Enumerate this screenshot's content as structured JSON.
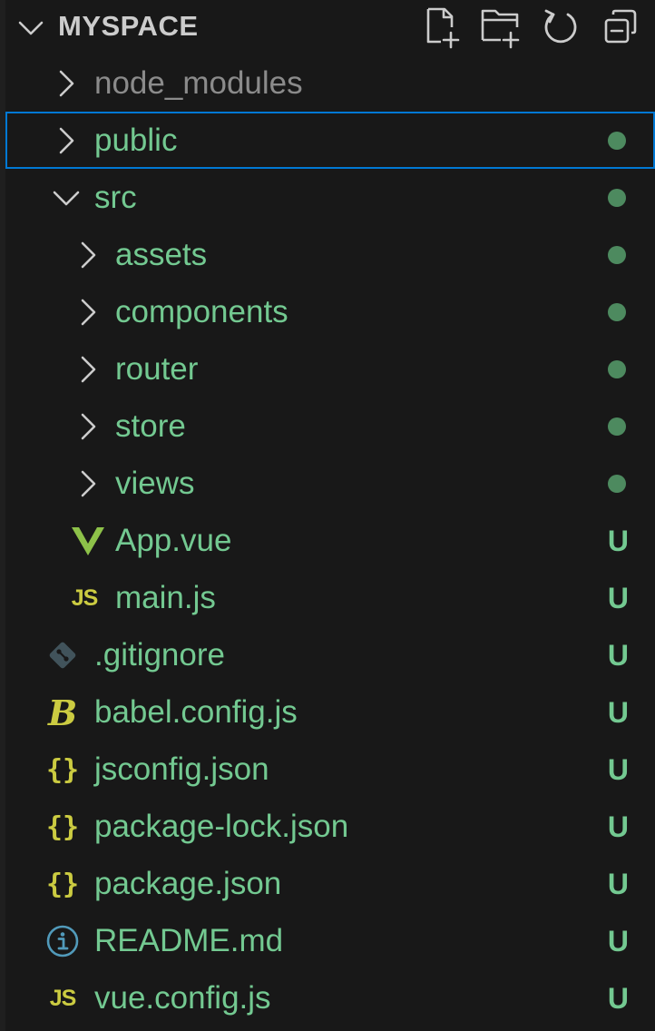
{
  "explorer": {
    "workspace_title": "MYSPACE",
    "header_icons": [
      "new-file-icon",
      "new-folder-icon",
      "refresh-icon",
      "collapse-all-icon"
    ]
  },
  "colors": {
    "background": "#181818",
    "untracked_green": "#73c991",
    "ignored_gray": "#8b8b8b",
    "selection_border": "#0078d4",
    "js_yellow": "#cbcb41",
    "vue_green": "#8dc149",
    "info_blue": "#519aba"
  },
  "tree": [
    {
      "label": "node_modules",
      "type": "folder",
      "expanded": false,
      "depth": 0,
      "status": "ignored",
      "decoration": ""
    },
    {
      "label": "public",
      "type": "folder",
      "expanded": false,
      "depth": 0,
      "status": "untracked",
      "decoration": "dot",
      "selected": true
    },
    {
      "label": "src",
      "type": "folder",
      "expanded": true,
      "depth": 0,
      "status": "untracked",
      "decoration": "dot"
    },
    {
      "label": "assets",
      "type": "folder",
      "expanded": false,
      "depth": 1,
      "status": "untracked",
      "decoration": "dot"
    },
    {
      "label": "components",
      "type": "folder",
      "expanded": false,
      "depth": 1,
      "status": "untracked",
      "decoration": "dot"
    },
    {
      "label": "router",
      "type": "folder",
      "expanded": false,
      "depth": 1,
      "status": "untracked",
      "decoration": "dot"
    },
    {
      "label": "store",
      "type": "folder",
      "expanded": false,
      "depth": 1,
      "status": "untracked",
      "decoration": "dot"
    },
    {
      "label": "views",
      "type": "folder",
      "expanded": false,
      "depth": 1,
      "status": "untracked",
      "decoration": "dot"
    },
    {
      "label": "App.vue",
      "type": "file",
      "icon": "vue-icon",
      "depth": 1,
      "status": "untracked",
      "decoration": "U"
    },
    {
      "label": "main.js",
      "type": "file",
      "icon": "js-icon",
      "icon_text": "JS",
      "depth": 1,
      "status": "untracked",
      "decoration": "U"
    },
    {
      "label": ".gitignore",
      "type": "file",
      "icon": "git-icon",
      "depth": 0,
      "status": "untracked",
      "decoration": "U"
    },
    {
      "label": "babel.config.js",
      "type": "file",
      "icon": "babel-icon",
      "icon_text": "B",
      "depth": 0,
      "status": "untracked",
      "decoration": "U"
    },
    {
      "label": "jsconfig.json",
      "type": "file",
      "icon": "json-icon",
      "icon_text": "{}",
      "depth": 0,
      "status": "untracked",
      "decoration": "U"
    },
    {
      "label": "package-lock.json",
      "type": "file",
      "icon": "json-icon",
      "icon_text": "{}",
      "depth": 0,
      "status": "untracked",
      "decoration": "U"
    },
    {
      "label": "package.json",
      "type": "file",
      "icon": "json-icon",
      "icon_text": "{}",
      "depth": 0,
      "status": "untracked",
      "decoration": "U"
    },
    {
      "label": "README.md",
      "type": "file",
      "icon": "info-icon",
      "depth": 0,
      "status": "untracked",
      "decoration": "U"
    },
    {
      "label": "vue.config.js",
      "type": "file",
      "icon": "js-icon",
      "icon_text": "JS",
      "depth": 0,
      "status": "untracked",
      "decoration": "U"
    }
  ]
}
